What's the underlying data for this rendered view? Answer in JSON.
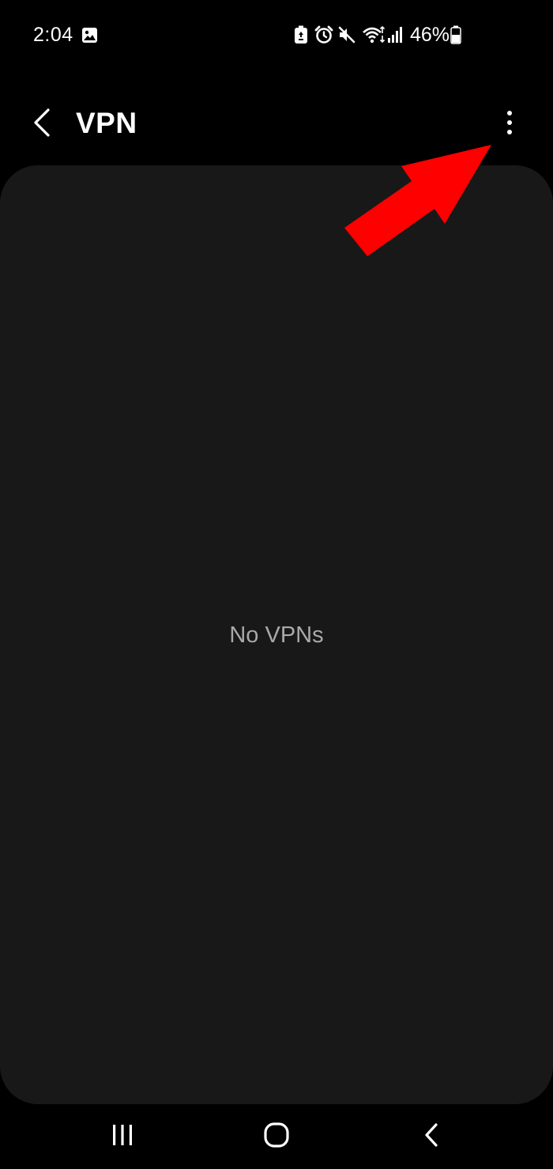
{
  "status_bar": {
    "time": "2:04",
    "battery_percent": "46%",
    "icons": [
      "gallery-notification-icon",
      "battery-saver-icon",
      "alarm-icon",
      "mute-icon",
      "wifi-icon",
      "signal-icon",
      "battery-icon"
    ]
  },
  "app_bar": {
    "title": "VPN",
    "back_icon": "chevron-left-icon",
    "more_icon": "more-vertical-icon"
  },
  "content": {
    "empty_message": "No VPNs"
  },
  "annotation": {
    "type": "arrow",
    "color": "#ff0000",
    "points_to": "more-options-button"
  },
  "nav_bar": {
    "buttons": [
      "recent-apps-icon",
      "home-icon",
      "back-icon"
    ]
  },
  "colors": {
    "background": "#000000",
    "card": "#181818",
    "empty_text": "#a9a9a9",
    "foreground": "#ffffff"
  }
}
